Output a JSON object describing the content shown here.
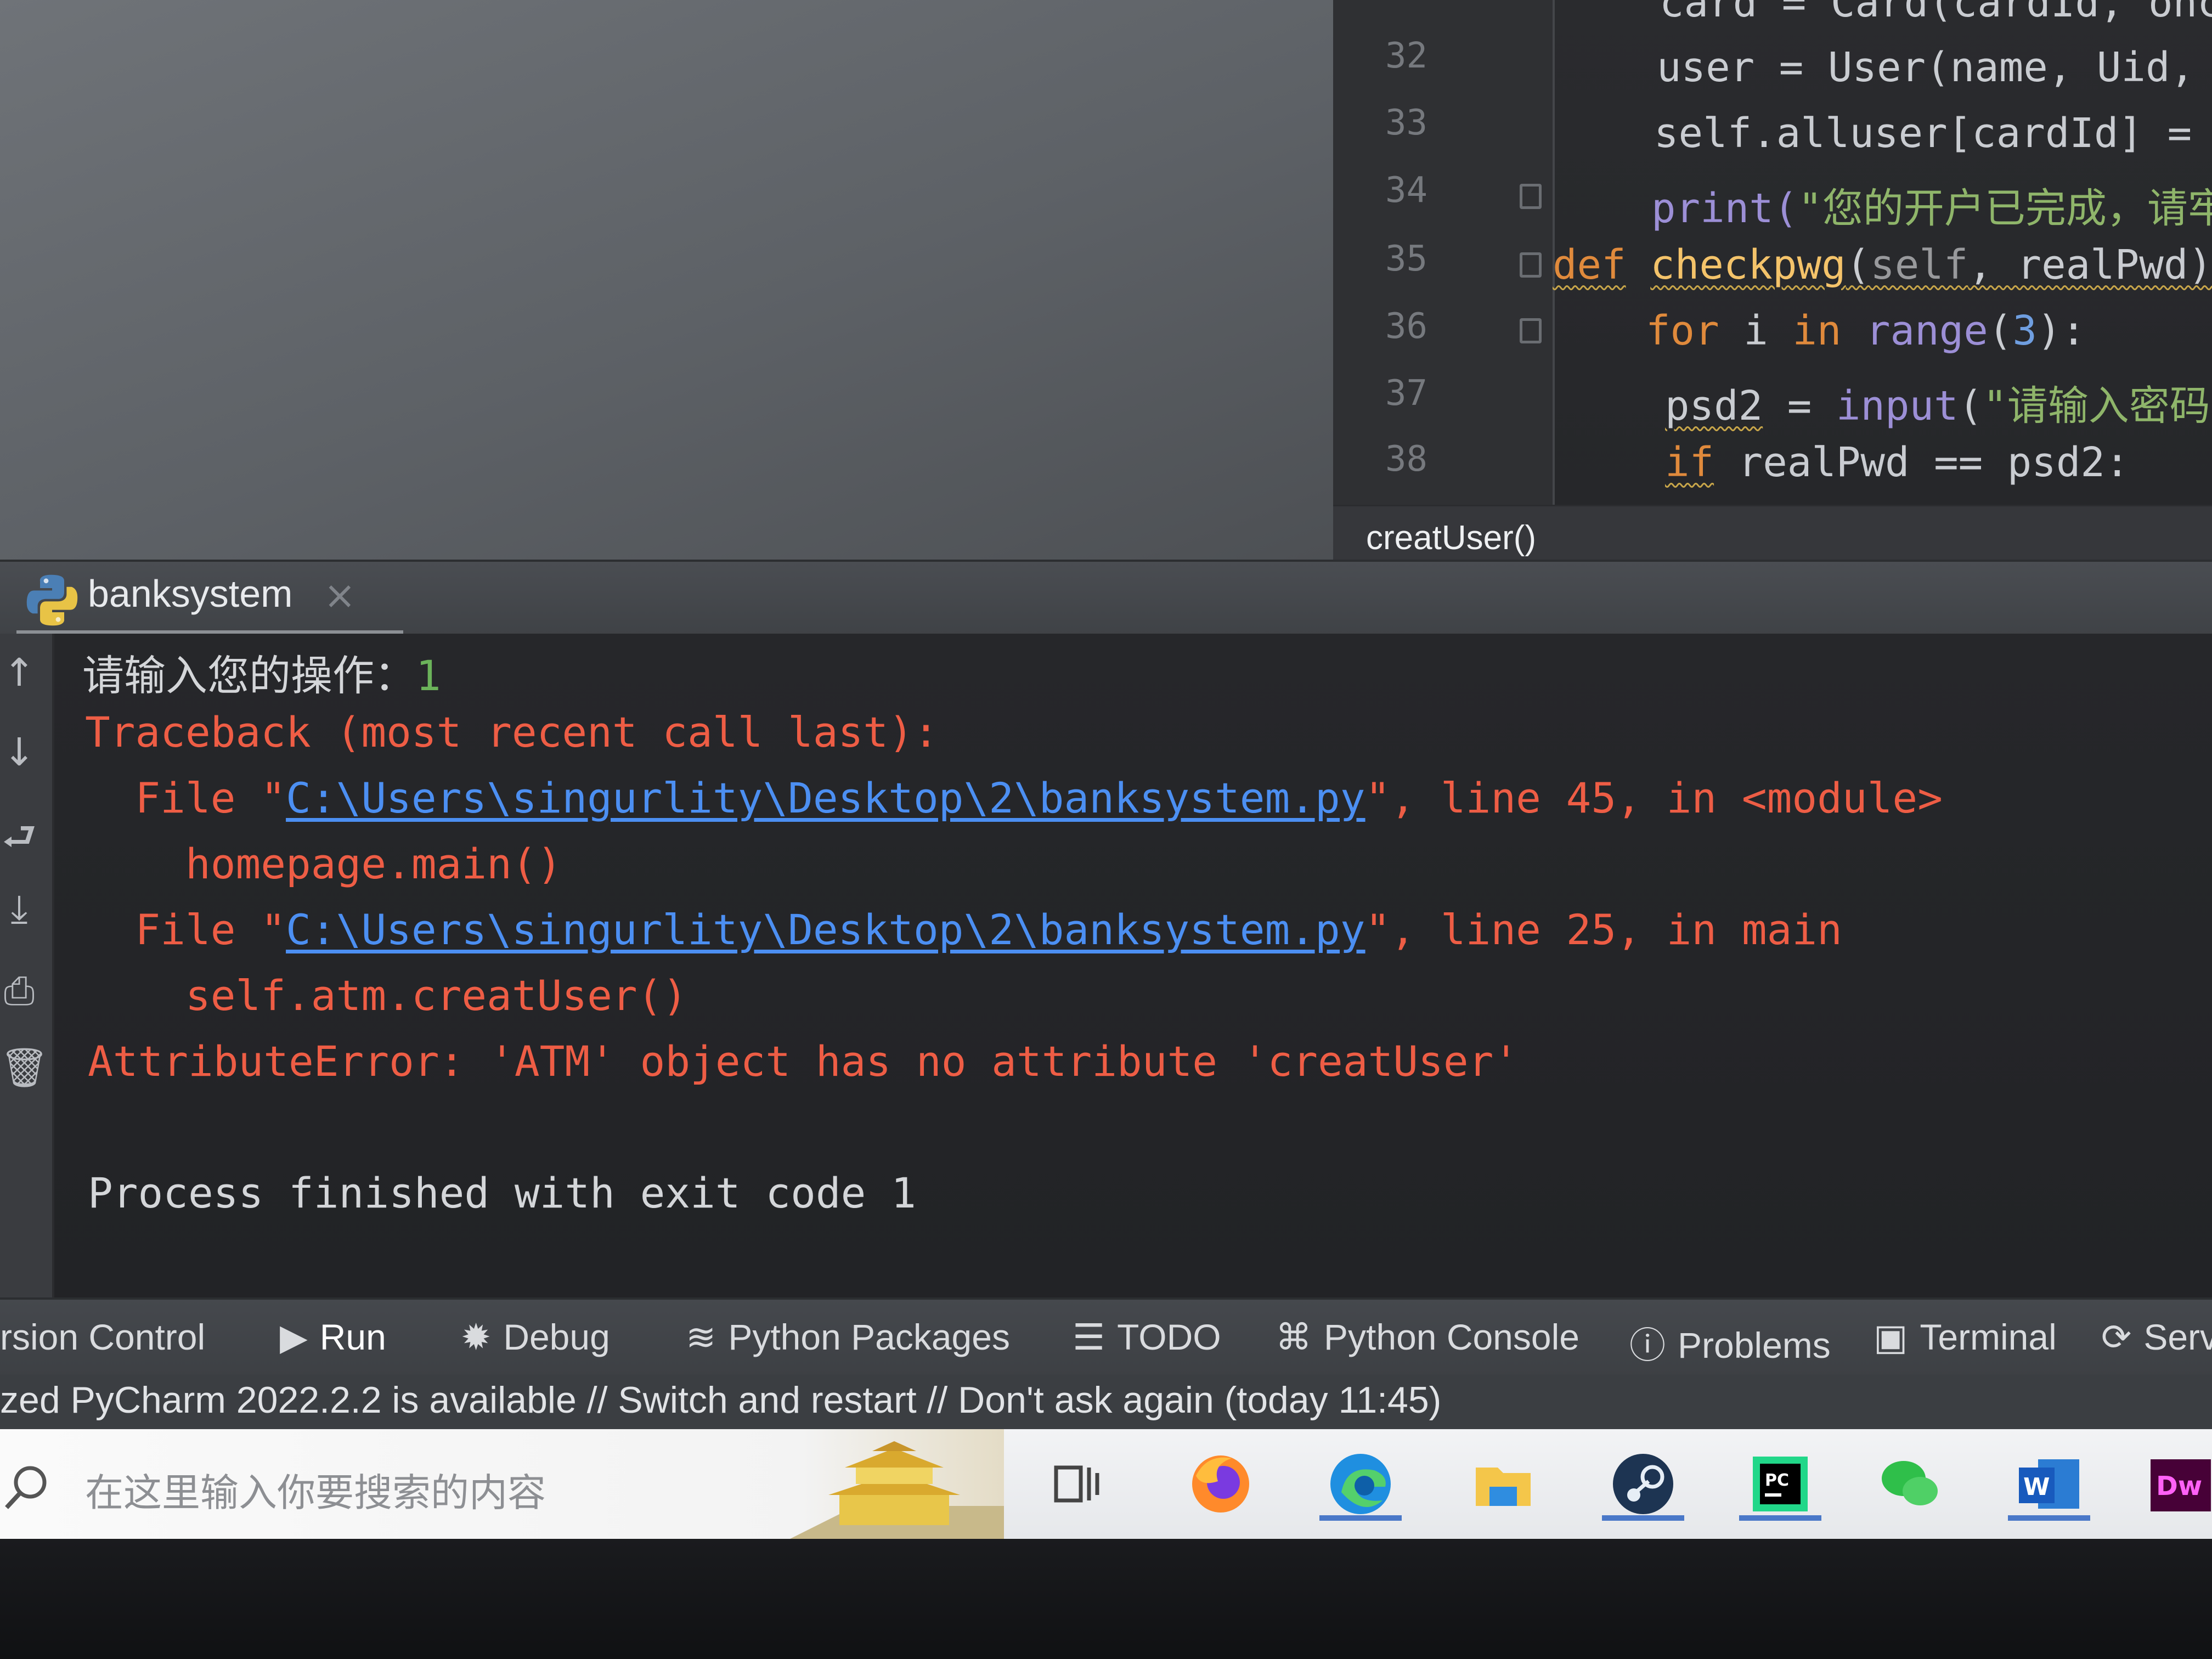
{
  "editor": {
    "lines": [
      {
        "num": "",
        "code": "card = Card(cardId, once"
      },
      {
        "num": "32",
        "code": "user = User(name, Uid, p"
      },
      {
        "num": "33",
        "code": "self.alluser[cardId] = u"
      },
      {
        "num": "34",
        "prefix": "print(",
        "str": "\"您的开户已完成，请牢记"
      },
      {
        "num": "35",
        "kw": "def",
        "fn": "checkpwg",
        "args_self": "self",
        "args_rest": ", realPwd):"
      },
      {
        "num": "36",
        "kw": "for",
        "mid1": " i ",
        "kw2": "in",
        "bi": "range",
        "open": "(",
        "num_lit": "3",
        "close": "):"
      },
      {
        "num": "37",
        "var": "psd2",
        "eq": " = ",
        "bi": "input",
        "open": "(",
        "str": "\"请输入密码:"
      },
      {
        "num": "38",
        "kw": "if",
        "rest": " realPwd == psd2:"
      }
    ],
    "breadcrumb": "creatUser()"
  },
  "run": {
    "tab_label": "banksystem",
    "tab_close": "×"
  },
  "console": {
    "prompt": "请输入您的操作：",
    "prompt_input": "1",
    "traceback": "Traceback (most recent call last):",
    "frame1_prefix": "  File \"",
    "frame1_path": "C:\\Users\\singurlity\\Desktop\\2\\banksystem.py",
    "frame1_suffix": "\", line 45, in <module>",
    "frame1_code": "    homepage.main()",
    "frame2_prefix": "  File \"",
    "frame2_path": "C:\\Users\\singurlity\\Desktop\\2\\banksystem.py",
    "frame2_suffix": "\", line 25, in main",
    "frame2_code": "    self.atm.creatUser()",
    "error": "AttributeError: 'ATM' object has no attribute 'creatUser'",
    "exit": "Process finished with exit code 1"
  },
  "toolbar": {
    "version_control": "rsion Control",
    "run": "Run",
    "debug": "Debug",
    "python_packages": "Python Packages",
    "todo": "TODO",
    "python_console": "Python Console",
    "problems": "Problems",
    "terminal": "Terminal",
    "services": "Serv"
  },
  "status": {
    "message": "zed PyCharm 2022.2.2 is available // Switch and restart // Don't ask again (today 11:45)"
  },
  "taskbar": {
    "search_placeholder": "在这里输入你要搜索的内容",
    "apps": [
      "task-view-icon",
      "firefox-icon",
      "edge-icon",
      "file-explorer-icon",
      "steam-icon",
      "pycharm-icon",
      "wechat-icon",
      "word-icon",
      "dreamweaver-icon"
    ]
  },
  "colors": {
    "error_red": "#ee5d45",
    "link_blue": "#4c8ff2",
    "keyword_orange": "#e08a3c",
    "input_green": "#6bb35a"
  }
}
